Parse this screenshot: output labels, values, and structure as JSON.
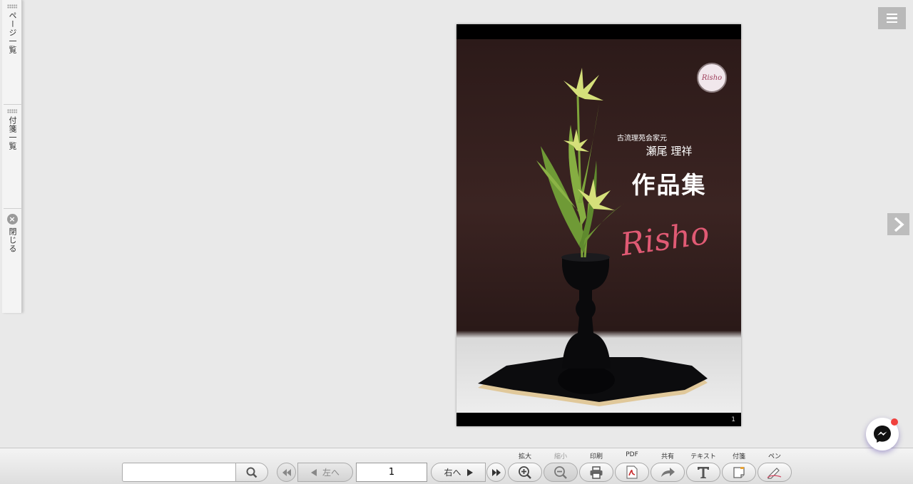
{
  "side_panel": {
    "page_list_label": "ページ一覧",
    "sticky_list_label": "付箋一覧",
    "close_label": "閉じる"
  },
  "cover": {
    "subtitle": "古流理苑会家元",
    "author": "瀬尾 理祥",
    "title": "作品集",
    "brand": "Risho",
    "logo_text": "Risho",
    "page_number": "1"
  },
  "toolbar": {
    "search_value": "",
    "prev_label": "左へ",
    "next_label": "右へ",
    "current_page": "1",
    "tools": {
      "zoom_in": "拡大",
      "zoom_out": "縮小",
      "print": "印刷",
      "pdf": "PDF",
      "share": "共有",
      "text": "テキスト",
      "sticky": "付箋",
      "pen": "ペン"
    }
  },
  "colors": {
    "accent": "#e05a74",
    "page_background": "#e9e9e9",
    "notification": "#f0413e"
  }
}
